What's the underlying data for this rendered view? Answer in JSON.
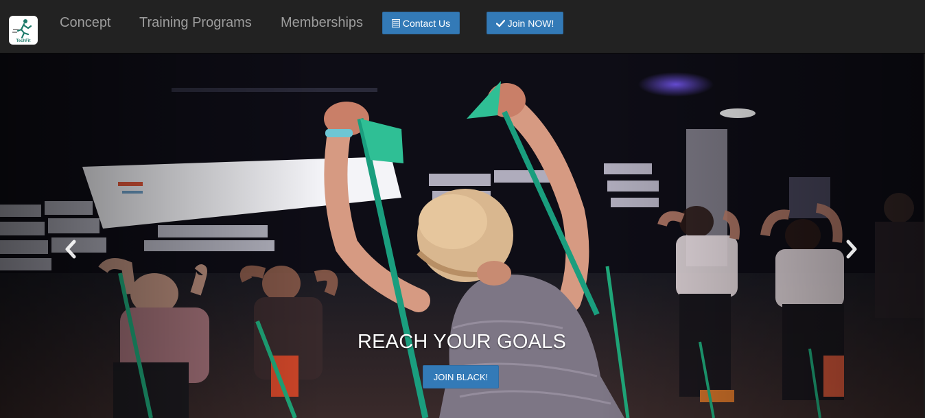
{
  "navbar": {
    "brand_text": "TechFit",
    "links": [
      "Concept",
      "Training Programs",
      "Memberships"
    ],
    "contact_label": "Contact Us",
    "join_label": "Join NOW!"
  },
  "hero": {
    "caption": "REACH YOUR GOALS",
    "cta_label": "JOIN BLACK!"
  },
  "icons": {
    "contact": "list-icon",
    "join": "checkmark-icon",
    "prev": "chevron-left-icon",
    "next": "chevron-right-icon"
  },
  "colors": {
    "navbar": "#222222",
    "nav_link": "#9d9d9d",
    "button": "#337ab7"
  }
}
